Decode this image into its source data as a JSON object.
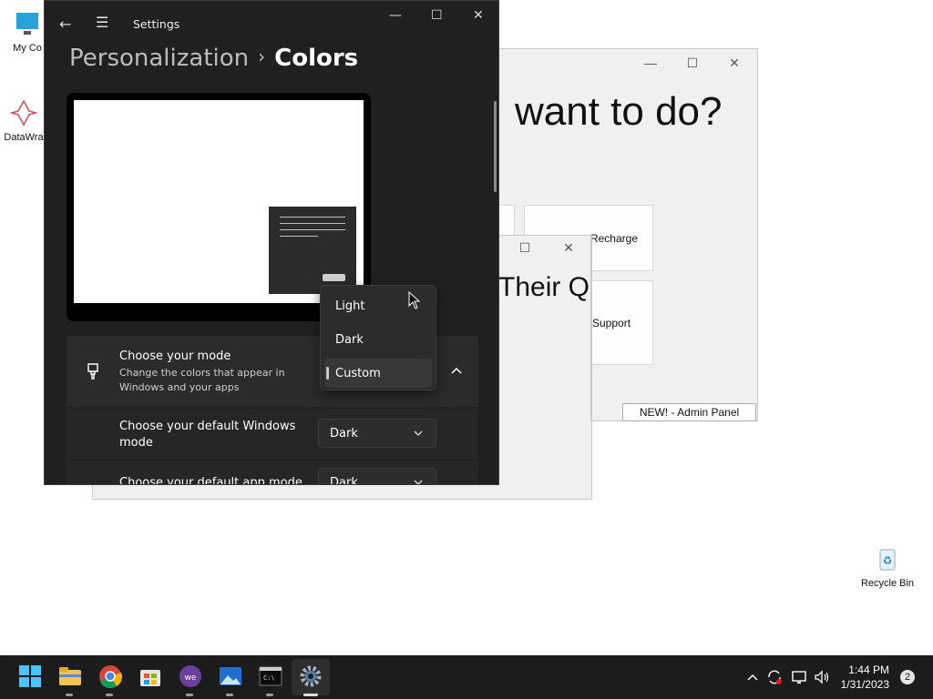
{
  "desktop": {
    "icons": [
      {
        "label": "My Co"
      },
      {
        "label": "DataWra"
      },
      {
        "label": "Recycle Bin"
      }
    ]
  },
  "bg_window_1": {
    "heading": "want to do?",
    "buttons": [
      {
        "label": "Recharge"
      },
      {
        "label": "Support"
      }
    ],
    "admin_button": "NEW! - Admin Panel"
  },
  "bg_window_2": {
    "heading": "Their Q"
  },
  "settings": {
    "app_title": "Settings",
    "breadcrumb": {
      "parent": "Personalization",
      "separator": "›",
      "current": "Colors"
    },
    "mode_card": {
      "title": "Choose your mode",
      "subtitle": "Change the colors that appear in Windows and your apps"
    },
    "windows_mode": {
      "title": "Choose your default Windows mode",
      "value": "Dark"
    },
    "app_mode": {
      "title": "Choose your default app mode",
      "value": "Dark"
    },
    "mode_menu": {
      "options": [
        "Light",
        "Dark",
        "Custom"
      ],
      "selected": "Custom"
    }
  },
  "taskbar": {
    "time": "1:44 PM",
    "date": "1/31/2023",
    "notifications": "2"
  }
}
